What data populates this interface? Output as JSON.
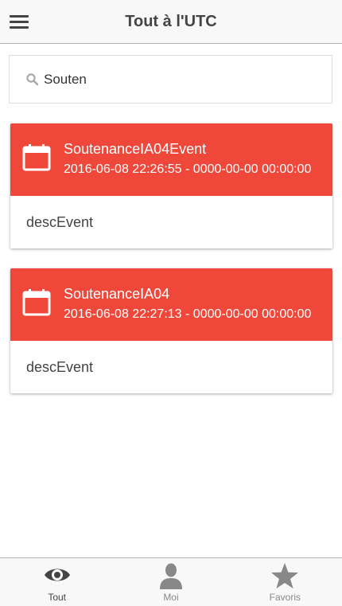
{
  "header": {
    "title": "Tout à l'UTC",
    "menu_icon": "hamburger-menu-icon"
  },
  "search": {
    "value": "Souten",
    "icon": "search-icon"
  },
  "events": [
    {
      "title": "SoutenanceIA04Event",
      "date": "2016-06-08 22:26:55 - 0000-00-00 00:00:00",
      "description": "descEvent",
      "icon": "calendar-icon"
    },
    {
      "title": "SoutenanceIA04",
      "date": "2016-06-08 22:27:13 - 0000-00-00 00:00:00",
      "description": "descEvent",
      "icon": "calendar-icon"
    }
  ],
  "tabs": [
    {
      "label": "Tout",
      "icon": "eye-icon",
      "active": true
    },
    {
      "label": "Moi",
      "icon": "person-icon",
      "active": false
    },
    {
      "label": "Favoris",
      "icon": "star-icon",
      "active": false
    }
  ],
  "colors": {
    "card_header": "#ef473a",
    "bar_background": "#f8f8f8",
    "active_tab": "#444444",
    "inactive_tab": "#888888"
  }
}
